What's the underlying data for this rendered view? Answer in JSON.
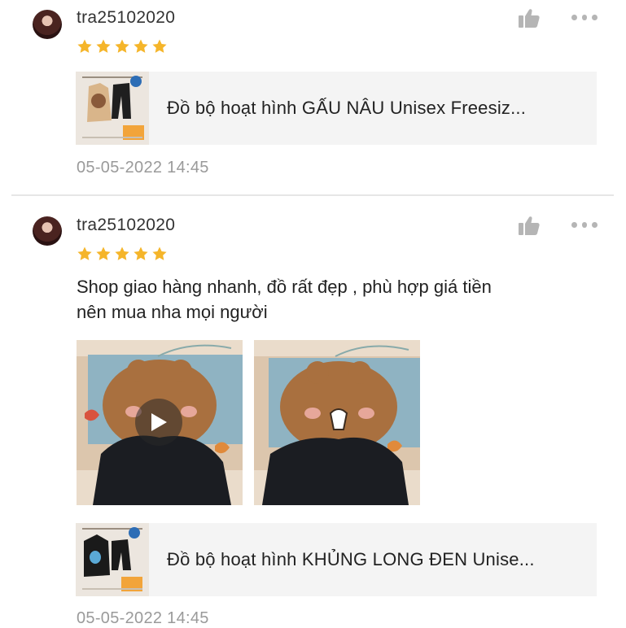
{
  "colors": {
    "star": "#f5b52a",
    "icon_gray": "#b5b5b5",
    "date_gray": "#9a9a9a",
    "product_bg": "#f4f4f4"
  },
  "reviews": [
    {
      "username": "tra25102020",
      "rating": 5,
      "comment": "",
      "product": {
        "name": "Đồ bộ hoạt hình GẤU NÂU Unisex Freesiz..."
      },
      "date": "05-05-2022 14:45"
    },
    {
      "username": "tra25102020",
      "rating": 5,
      "comment_line1": "Shop giao hàng nhanh, đồ rất đẹp , phù hợp giá tiền",
      "comment_line2": "nên mua nha mọi người",
      "media": [
        {
          "type": "video",
          "icon": "play-icon"
        },
        {
          "type": "image"
        }
      ],
      "product": {
        "name": "Đồ bộ hoạt hình KHỦNG LONG ĐEN Unise..."
      },
      "date": "05-05-2022 14:45"
    }
  ],
  "icons": {
    "like": "thumbs-up-icon",
    "more": "more-options-icon",
    "star": "star-icon"
  }
}
